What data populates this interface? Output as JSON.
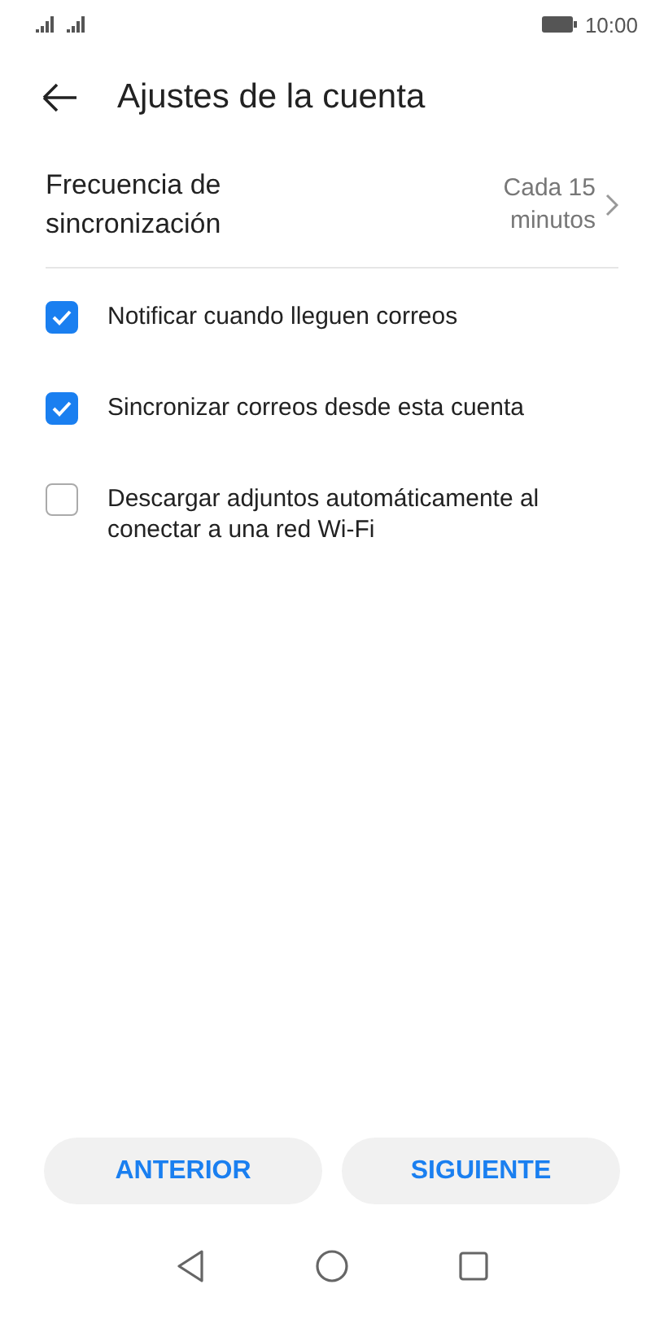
{
  "status_bar": {
    "time": "10:00"
  },
  "header": {
    "title": "Ajustes de la cuenta"
  },
  "sync_setting": {
    "label": "Frecuencia de sincronización",
    "value": "Cada 15 minutos"
  },
  "options": [
    {
      "label": "Notificar cuando lleguen correos",
      "checked": true
    },
    {
      "label": "Sincronizar correos desde esta cuenta",
      "checked": true
    },
    {
      "label": "Descargar adjuntos automáticamente al conectar a una red Wi-Fi",
      "checked": false
    }
  ],
  "buttons": [
    "ANTERIOR",
    "SIGUIENTE"
  ]
}
